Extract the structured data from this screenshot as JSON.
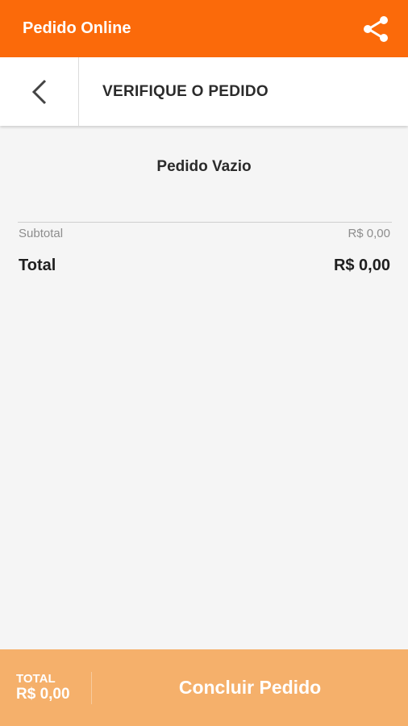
{
  "appbar": {
    "title": "Pedido Online",
    "share_icon": "share-icon"
  },
  "subheader": {
    "back_icon": "chevron-left-icon",
    "title": "VERIFIQUE O PEDIDO"
  },
  "order": {
    "empty_message": "Pedido Vazio",
    "subtotal_label": "Subtotal",
    "subtotal_value": "R$ 0,00",
    "total_label": "Total",
    "total_value": "R$ 0,00"
  },
  "footer": {
    "total_label": "TOTAL",
    "total_value": "R$ 0,00",
    "checkout_label": "Concluir Pedido"
  },
  "colors": {
    "primary": "#fb6a0a",
    "footer": "#f5b06b",
    "background": "#f5f5f5"
  }
}
